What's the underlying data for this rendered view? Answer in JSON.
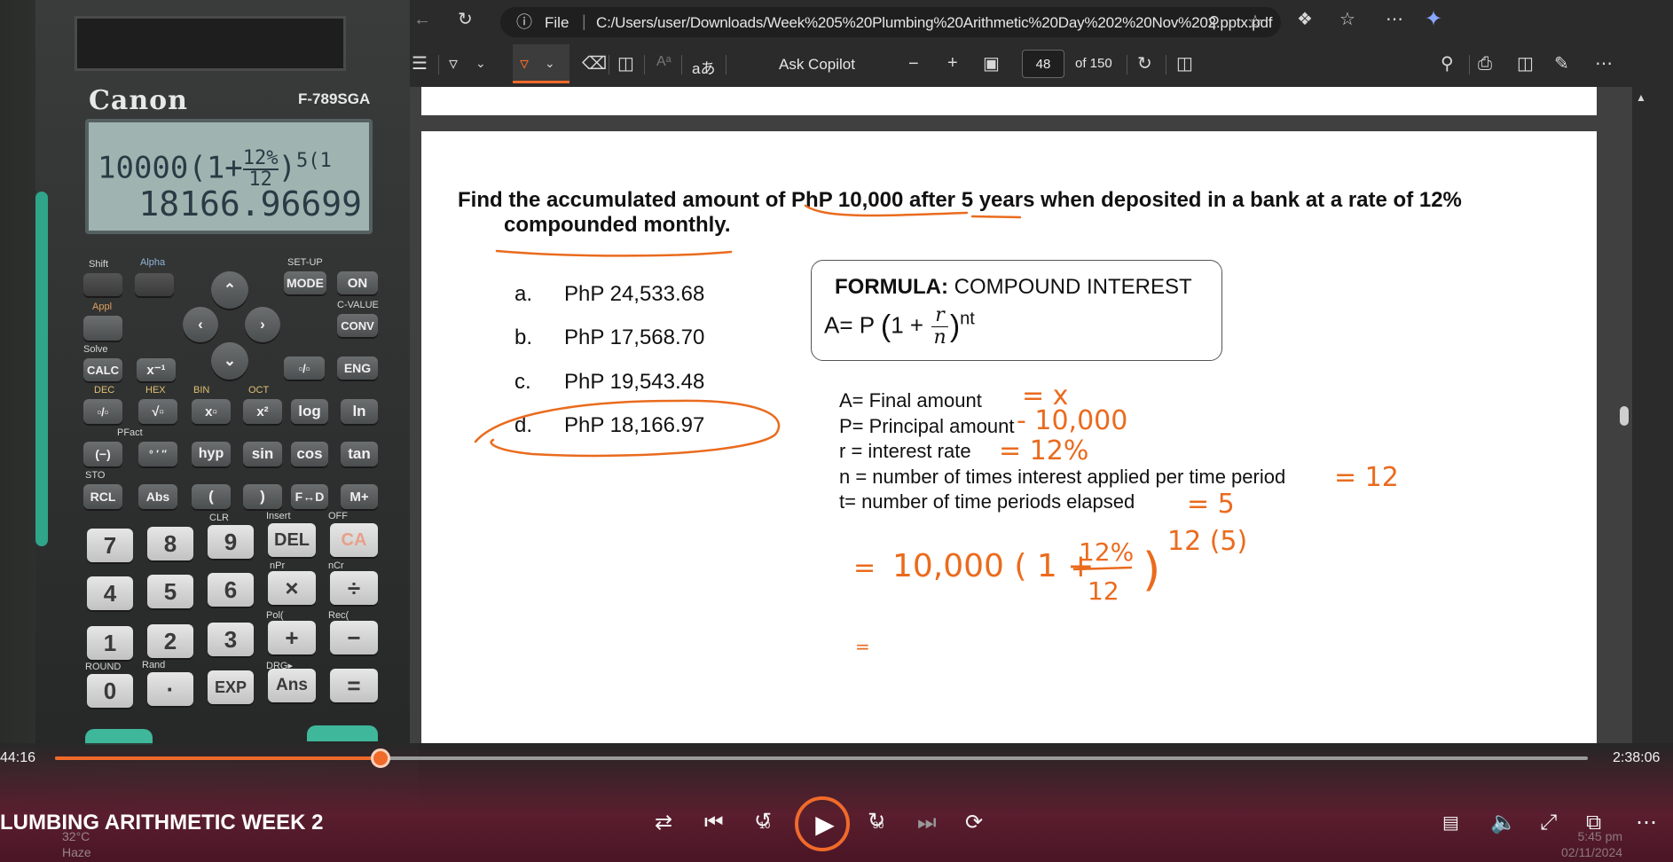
{
  "calculator": {
    "brand": "Canon",
    "model": "F-789SGA",
    "display_expression": "10000(1+12%/12)^5(1",
    "display_expr_base": "10000(1+",
    "display_frac_num": "12%",
    "display_frac_den": "12",
    "display_exp": "5(1",
    "display_result": "18166.96699",
    "keys": {
      "mode": "MODE",
      "on": "ON",
      "calc": "CALC",
      "conv": "CONV",
      "eng": "ENG",
      "log": "log",
      "ln": "ln",
      "hyp": "hyp",
      "sin": "sin",
      "cos": "cos",
      "tan": "tan",
      "rcl": "RCL",
      "abs": "Abs",
      "lparen": "(",
      "rparen": ")",
      "fd": "F↔D",
      "mplus": "M+",
      "n7": "7",
      "n8": "8",
      "n9": "9",
      "del": "DEL",
      "ca": "CA",
      "n4": "4",
      "n5": "5",
      "n6": "6",
      "mul": "×",
      "div": "÷",
      "n1": "1",
      "n2": "2",
      "n3": "3",
      "plus": "+",
      "minus": "−",
      "n0": "0",
      "dot": "·",
      "exp": "EXP",
      "ans": "Ans",
      "eq": "="
    },
    "labels": {
      "shift": "Shift",
      "alpha": "Alpha",
      "setup": "SET-UP",
      "cvalue": "C-VALUE",
      "solve": "Solve",
      "dec": "DEC",
      "hex": "HEX",
      "bin": "BIN",
      "oct": "OCT",
      "pfact": "PFact",
      "sto": "STO",
      "clr": "CLR",
      "insert": "Insert",
      "off": "OFF",
      "npr": "nPr",
      "ncr": "nCr",
      "pol": "Pol(",
      "rec": "Rec(",
      "round": "ROUND",
      "rand": "Rand",
      "drg": "DRG▸",
      "appl": "Appl"
    }
  },
  "browser": {
    "file_label": "File",
    "url": "C:/Users/user/Downloads/Week%205%20Plumbing%20Arithmetic%20Day%202%20Nov%202.pptx.pdf",
    "read_aloud": "aあ",
    "ask_copilot": "Ask Copilot",
    "page_current": "48",
    "page_total": "of 150"
  },
  "slide": {
    "question_line1": "Find the accumulated amount of PhP 10,000 after 5 years when deposited in a bank at a rate of 12%",
    "question_line2": "compounded monthly.",
    "choices": [
      {
        "letter": "a.",
        "text": "PhP 24,533.68"
      },
      {
        "letter": "b.",
        "text": "PhP 17,568.70"
      },
      {
        "letter": "c.",
        "text": "PhP 19,543.48"
      },
      {
        "letter": "d.",
        "text": "PhP 18,166.97"
      }
    ],
    "formula_label": "FORMULA:",
    "formula_name": "COMPOUND INTEREST",
    "formula_prefix": "A= P",
    "formula_paren_open": "(1 +",
    "formula_frac_num": "r",
    "formula_frac_den": "n",
    "formula_paren_close": ")",
    "formula_exp": "nt",
    "definitions": [
      "A= Final amount",
      "P= Principal amount",
      "r = interest rate",
      "n = number of times interest applied per time period",
      "t= number of time periods elapsed"
    ],
    "annotations": {
      "a_val": "= x",
      "p_val": "- 10,000",
      "r_val": "= 12%",
      "n_val": "= 12",
      "t_val": "= 5",
      "work_eq": "=",
      "work_base": "10,000 ( 1 +",
      "work_num": "12%",
      "work_den": "12",
      "work_close": ")",
      "work_exp": "12 (5)",
      "next_eq": "="
    }
  },
  "player": {
    "elapsed": "44:16",
    "duration": "2:38:06",
    "progress": 0.2125,
    "title": "LUMBING ARITHMETIC WEEK 2",
    "skip_back": "10",
    "skip_fwd": "30",
    "accent": "#f06a2a"
  },
  "taskbar": {
    "temp": "32°C",
    "weather": "Haze",
    "time": "5:45 pm",
    "date": "02/11/2024"
  }
}
